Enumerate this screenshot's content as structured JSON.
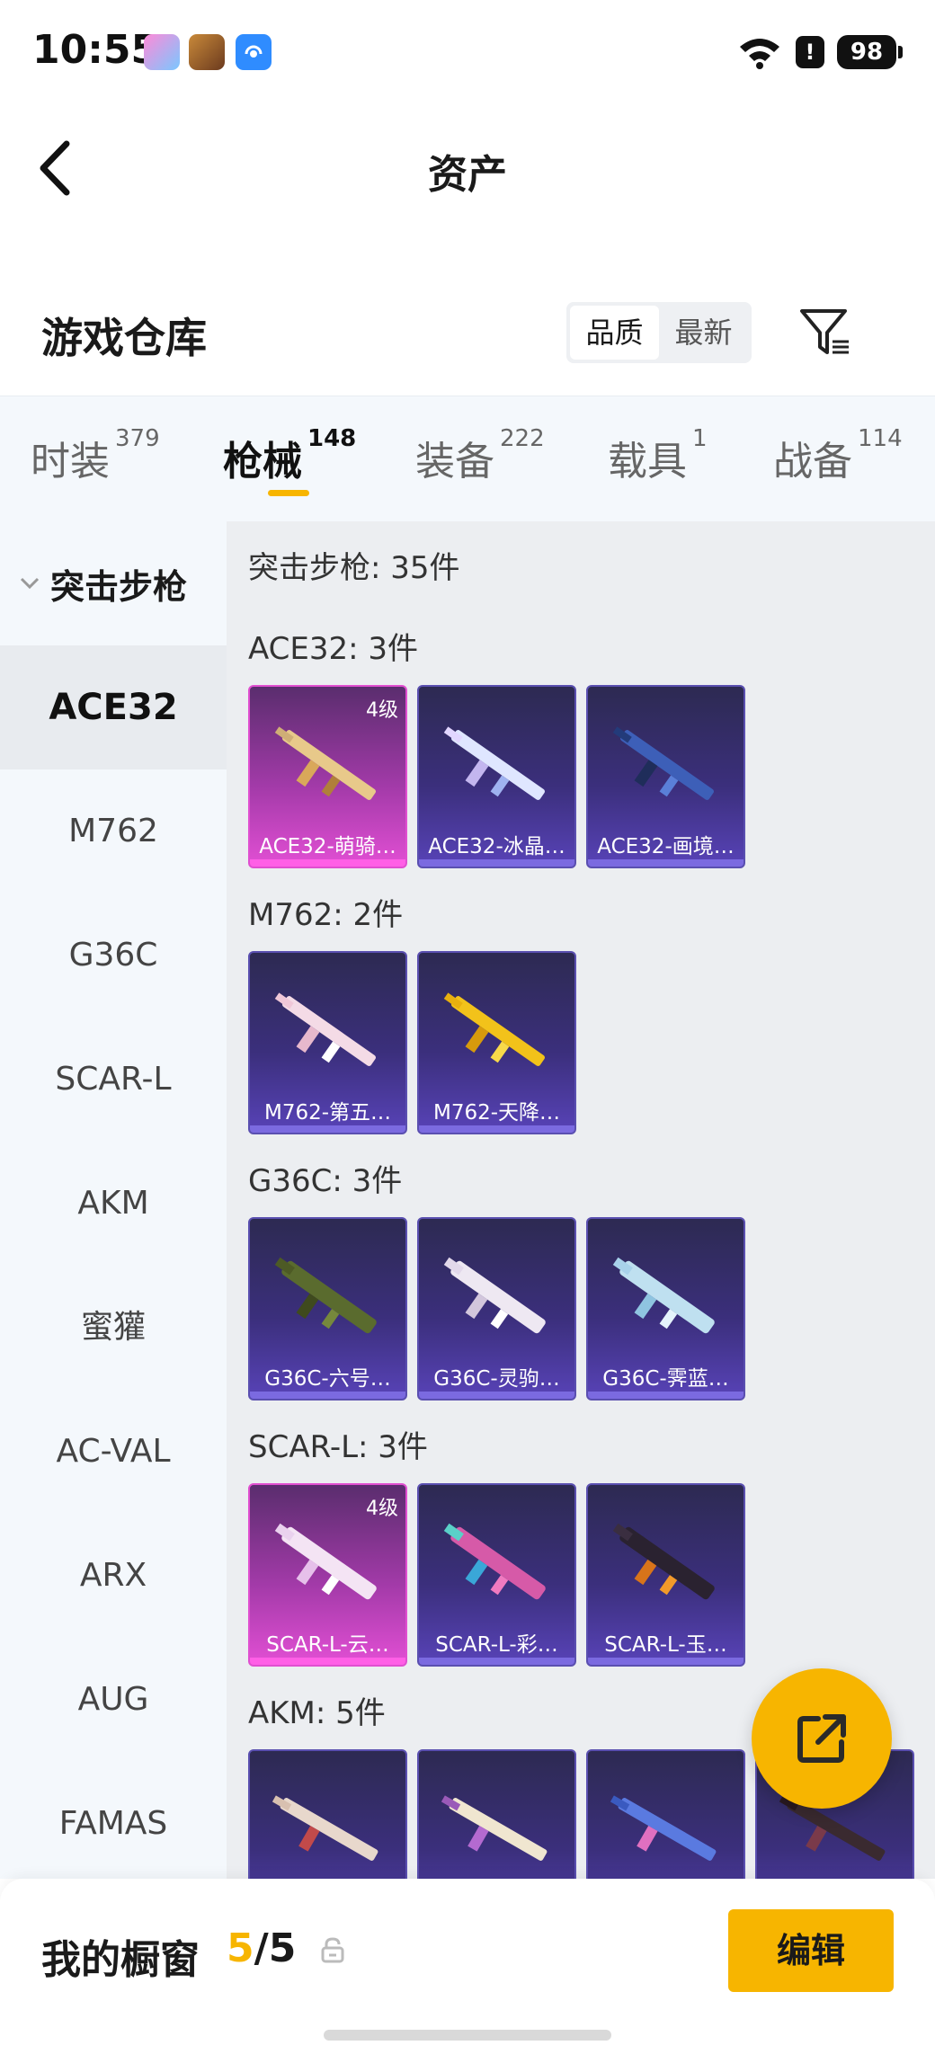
{
  "status_bar": {
    "time": "10:55",
    "battery": "98",
    "alert": "!",
    "icons": [
      "app-icon-1",
      "game-avatar-icon",
      "hotspot-app-icon",
      "wifi-icon",
      "alert-icon",
      "battery-icon"
    ]
  },
  "header": {
    "title": "资产",
    "back_icon": "back-arrow-icon"
  },
  "warehouse": {
    "title": "游戏仓库",
    "sort_options": [
      "品质",
      "最新"
    ],
    "sort_selected": "品质",
    "filter_icon": "filter-icon"
  },
  "tabs": [
    {
      "label": "时装",
      "count": "379"
    },
    {
      "label": "枪械",
      "count": "148",
      "active": true
    },
    {
      "label": "装备",
      "count": "222"
    },
    {
      "label": "载具",
      "count": "1"
    },
    {
      "label": "战备",
      "count": "114"
    }
  ],
  "sidebar": {
    "group": "突击步枪",
    "items": [
      "ACE32",
      "M762",
      "G36C",
      "SCAR-L",
      "AKM",
      "蜜獾",
      "AC-VAL",
      "ARX",
      "AUG",
      "FAMAS"
    ],
    "active": "ACE32"
  },
  "content": {
    "total": "突击步枪: 35件",
    "sections": [
      {
        "title": "ACE32: 3件",
        "items": [
          {
            "label": "ACE32-萌骑…",
            "level": "4级",
            "rarity": "pink"
          },
          {
            "label": "ACE32-冰晶…",
            "rarity": "purple"
          },
          {
            "label": "ACE32-画境…",
            "rarity": "purple"
          }
        ]
      },
      {
        "title": "M762: 2件",
        "items": [
          {
            "label": "M762-第五…",
            "rarity": "purple"
          },
          {
            "label": "M762-天降…",
            "rarity": "purple"
          }
        ]
      },
      {
        "title": "G36C: 3件",
        "items": [
          {
            "label": "G36C-六号…",
            "rarity": "purple"
          },
          {
            "label": "G36C-灵驹…",
            "rarity": "purple"
          },
          {
            "label": "G36C-霁蓝…",
            "rarity": "purple"
          }
        ]
      },
      {
        "title": "SCAR-L: 3件",
        "items": [
          {
            "label": "SCAR-L-云…",
            "level": "4级",
            "rarity": "pink"
          },
          {
            "label": "SCAR-L-彩…",
            "rarity": "purple"
          },
          {
            "label": "SCAR-L-玉…",
            "rarity": "purple"
          }
        ]
      },
      {
        "title": "AKM: 5件",
        "items": []
      }
    ]
  },
  "fab": {
    "icon": "share-external-icon"
  },
  "bottom_bar": {
    "label": "我的橱窗",
    "count_current": "5",
    "count_sep": "/",
    "count_total": "5",
    "lock_icon": "lock-icon",
    "edit_label": "编辑"
  },
  "colors": {
    "accent": "#f7b500",
    "purple_card": "#4a3da0",
    "pink_card": "#d63ec7"
  }
}
